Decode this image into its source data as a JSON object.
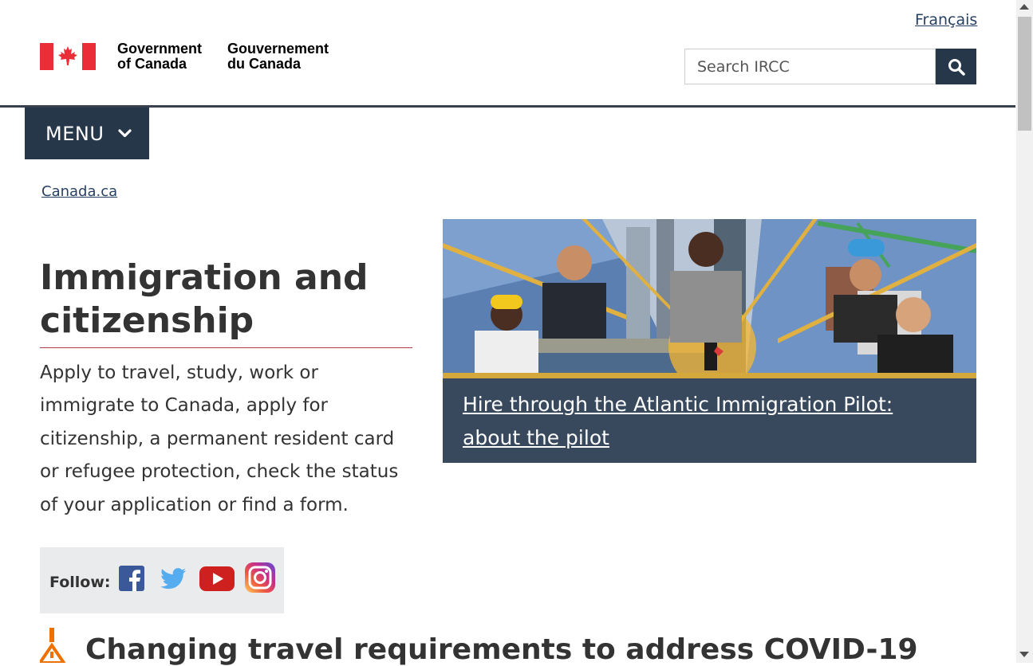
{
  "header": {
    "language_link": "Français",
    "signature_en_line1": "Government",
    "signature_en_line2": "of Canada",
    "signature_fr_line1": "Gouvernement",
    "signature_fr_line2": "du Canada",
    "search_placeholder": "Search IRCC",
    "search_button_icon": "search-icon"
  },
  "menu": {
    "label": "MENU",
    "icon": "chevron-down-icon"
  },
  "breadcrumb": {
    "item": "Canada.ca"
  },
  "main": {
    "title": "Immigration and citizenship",
    "intro": "Apply to travel, study, work or immigrate to Canada, apply for citizenship, a permanent resident card or refugee protection, check the status of your application or find a form.",
    "follow_label": "Follow:",
    "social_icons": [
      "facebook-icon",
      "twitter-icon",
      "youtube-icon",
      "instagram-icon"
    ]
  },
  "feature": {
    "link": "Hire through the Atlantic Immigration Pilot: about the pilot"
  },
  "alert": {
    "heading": "Changing travel requirements to address COVID-19",
    "icon": "warning-icon"
  },
  "colors": {
    "brand_dark": "#26374a",
    "link": "#284162",
    "accent_red": "#af3c43",
    "flag_red": "#eb2d37",
    "feature_caption_bg": "#38495e",
    "warning_orange": "#ee7100"
  }
}
